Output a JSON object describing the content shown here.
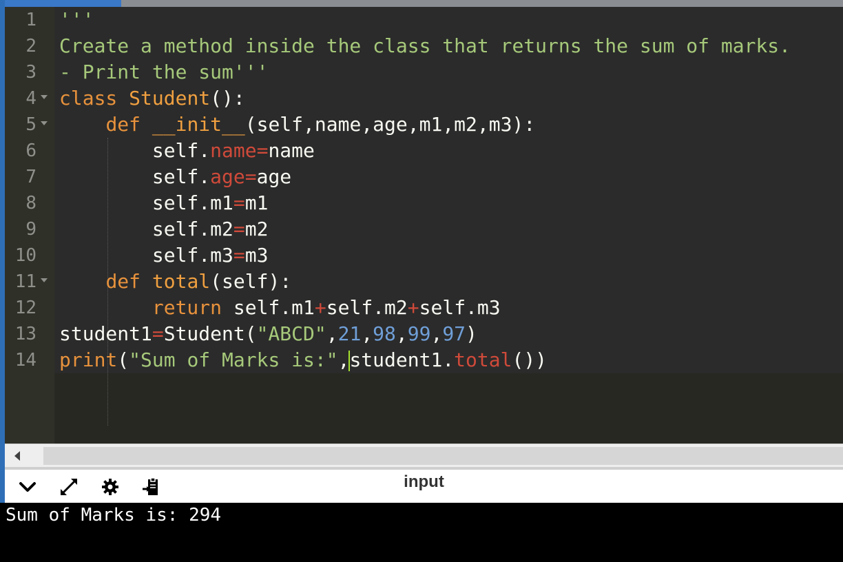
{
  "editor": {
    "line_numbers": [
      "1",
      "2",
      "3",
      "4",
      "5",
      "6",
      "7",
      "8",
      "9",
      "10",
      "11",
      "12",
      "13",
      "14"
    ],
    "line1_str": "'''",
    "line2_str": "Create a method inside the class that returns the sum of marks.",
    "line3_str": "- Print the sum'''",
    "line4": {
      "kw": "class",
      "name": "Student",
      "rest": "():"
    },
    "line5": {
      "kw": "def",
      "name": "__init__",
      "rest": "(self,name,age,m1,m2,m3):"
    },
    "line6": {
      "self": "self.",
      "prop": "name",
      "op": "=",
      "val": "name"
    },
    "line7": {
      "self": "self.",
      "prop": "age",
      "op": "=",
      "val": "age"
    },
    "line8": {
      "lhs": "self.m1",
      "op": "=",
      "val": "m1"
    },
    "line9": {
      "lhs": "self.m2",
      "op": "=",
      "val": "m2"
    },
    "line10": {
      "lhs": "self.m3",
      "op": "=",
      "val": "m3"
    },
    "line11": {
      "kw": "def",
      "name": "total",
      "rest": "(self):"
    },
    "line12": {
      "kw": "return",
      "a": "self.m1",
      "op1": "+",
      "b": "self.m2",
      "op2": "+",
      "c": "self.m3"
    },
    "line13": {
      "var": "student1",
      "op": "=",
      "call": "Student(",
      "str": "\"ABCD\"",
      "c1": ",",
      "n1": "21",
      "c2": ",",
      "n2": "98",
      "c3": ",",
      "n3": "99",
      "c4": ",",
      "n4": "97",
      "close": ")"
    },
    "line14": {
      "fn": "print",
      "open": "(",
      "str": "\"Sum of Marks is:\"",
      "comma": ",",
      "obj": "student1.",
      "method": "total",
      "close": "())"
    }
  },
  "panel": {
    "input_label": "input",
    "icons": [
      "collapse-chevron-icon",
      "expand-arrows-icon",
      "settings-gear-icon",
      "clipboard-paste-icon"
    ]
  },
  "console": {
    "output": "Sum of Marks is: 294"
  },
  "colors": {
    "string": "#a6c97a",
    "keyword": "#e8923c",
    "property": "#d04a3a",
    "number": "#6f9fd8"
  }
}
